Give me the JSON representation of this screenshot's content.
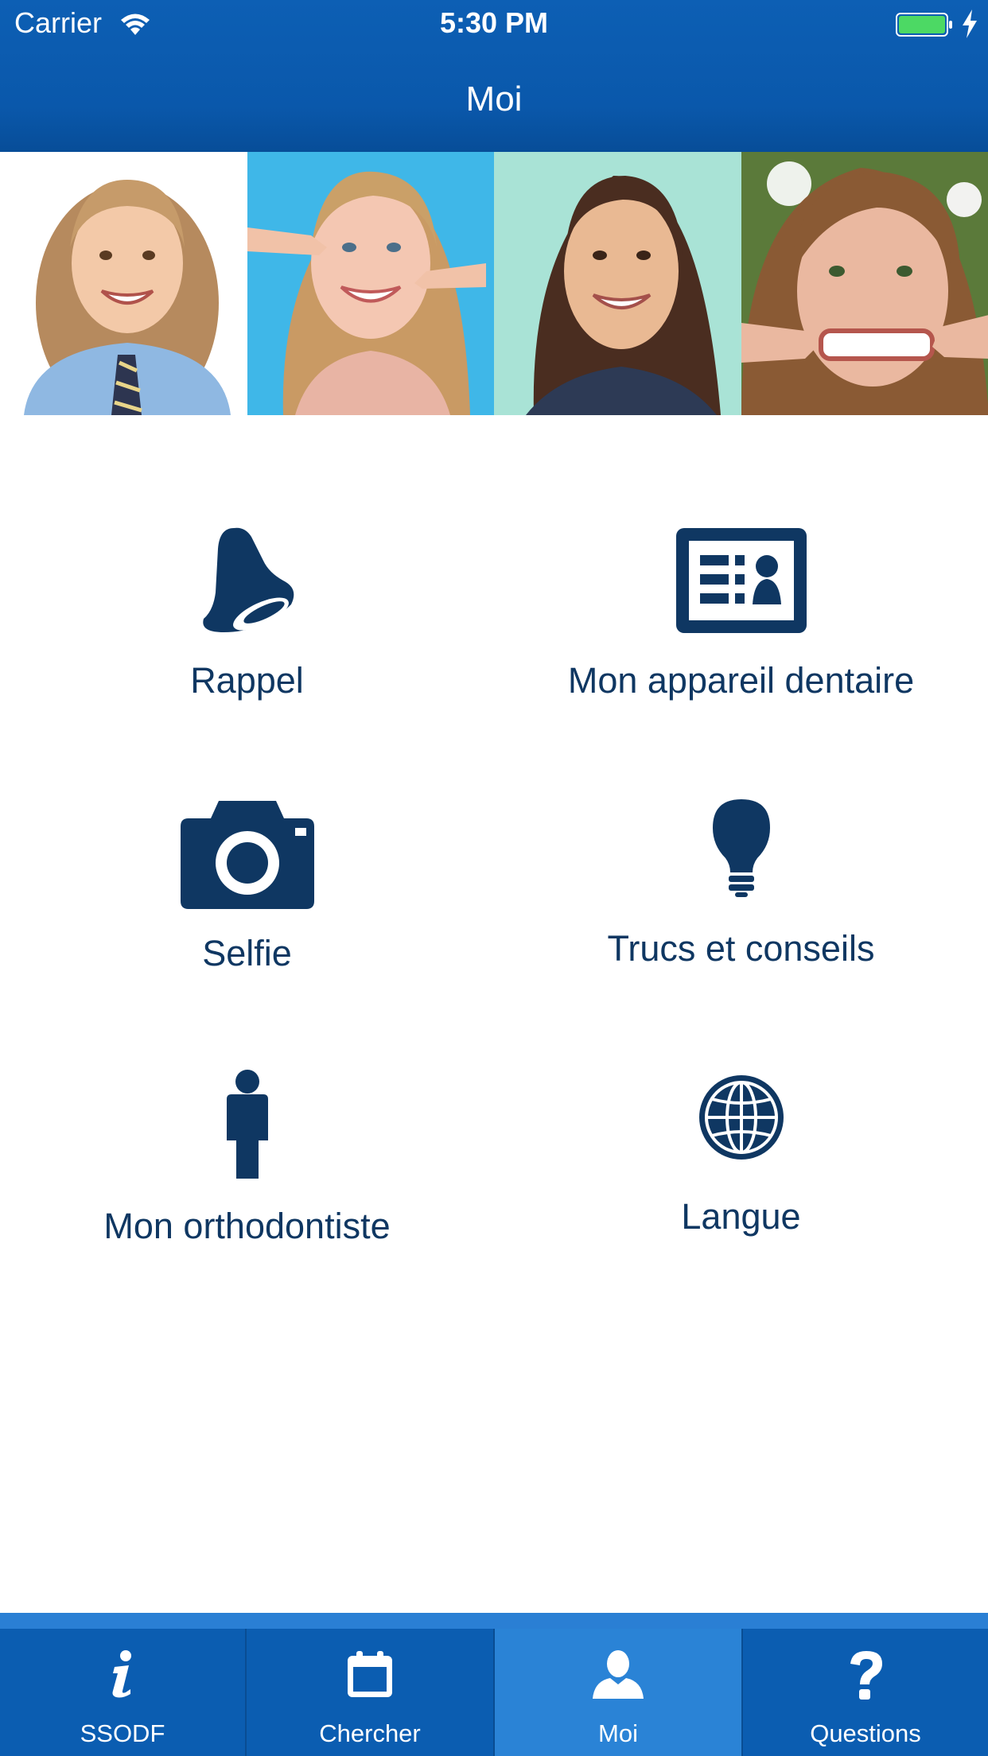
{
  "status_bar": {
    "carrier": "Carrier",
    "time": "5:30 PM"
  },
  "header": {
    "title": "Moi"
  },
  "menu": {
    "items": [
      {
        "label": "Rappel",
        "icon": "bell-icon"
      },
      {
        "label": "Mon appareil dentaire",
        "icon": "id-card-icon"
      },
      {
        "label": "Selfie",
        "icon": "camera-icon"
      },
      {
        "label": "Trucs et conseils",
        "icon": "lightbulb-icon"
      },
      {
        "label": "Mon orthodontiste",
        "icon": "person-icon"
      },
      {
        "label": "Langue",
        "icon": "globe-icon"
      }
    ]
  },
  "tabbar": {
    "tabs": [
      {
        "label": "SSODF",
        "icon": "info-icon"
      },
      {
        "label": "Chercher",
        "icon": "calendar-icon"
      },
      {
        "label": "Moi",
        "icon": "user-icon",
        "active": true
      },
      {
        "label": "Questions",
        "icon": "question-icon"
      }
    ]
  },
  "colors": {
    "header": "#0a58ab",
    "icon": "#0f3762",
    "tab_active": "#2a83d6"
  }
}
